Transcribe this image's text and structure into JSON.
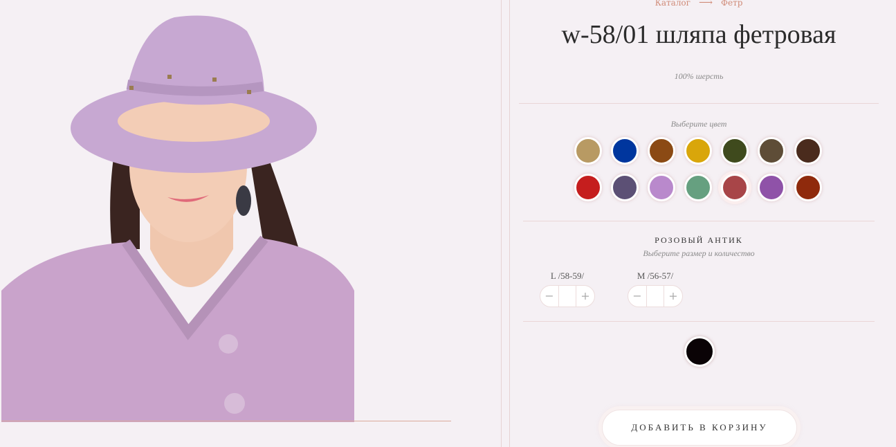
{
  "breadcrumb": {
    "parent": "Каталог",
    "current": "Фетр"
  },
  "product": {
    "title": "w-58/01 шляпа фетровая",
    "material": "100% шерсть"
  },
  "colors": {
    "prompt": "Выберите цвет",
    "swatches": [
      "#b89a63",
      "#00369e",
      "#8b4a14",
      "#d9a60a",
      "#3f4a1d",
      "#5e4d37",
      "#4a2b1d",
      "#c51e1e",
      "#5c5075",
      "#b989cc",
      "#66a080",
      "#a84548",
      "#8f52a8",
      "#8f2a0c"
    ],
    "selected_index": 11,
    "selected_name": "РОЗОВЫЙ АНТИК"
  },
  "sizes": {
    "prompt": "Выберите размер и количество",
    "items": [
      {
        "label": "L /58-59/",
        "minus": "−",
        "plus": "+",
        "qty": ""
      },
      {
        "label": "M /56-57/",
        "minus": "−",
        "plus": "+",
        "qty": ""
      }
    ]
  },
  "cart": {
    "label": "ДОБАВИТЬ В КОРЗИНУ"
  },
  "accent_color": "#d08b78"
}
